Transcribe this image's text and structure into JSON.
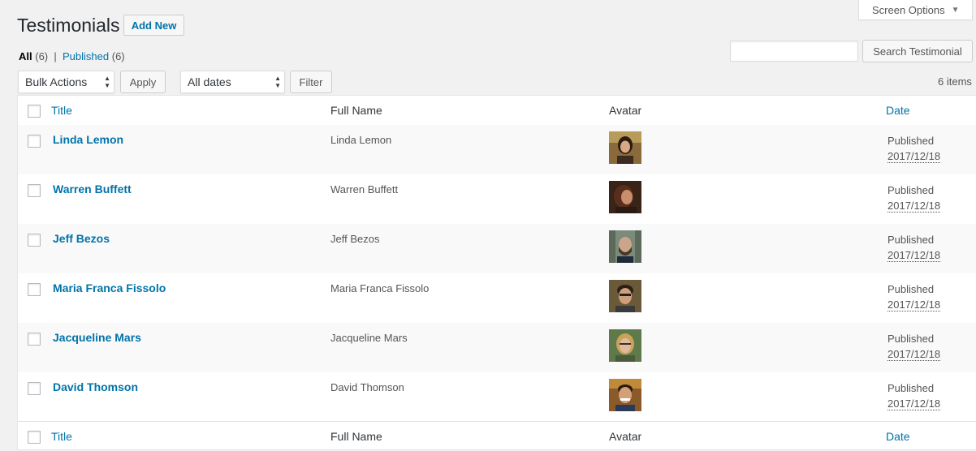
{
  "screen_options": {
    "label": "Screen Options",
    "arrow": "▼"
  },
  "page": {
    "title": "Testimonials",
    "add_new": "Add New"
  },
  "views": {
    "all_label": "All",
    "all_count": "(6)",
    "separator": "|",
    "published_label": "Published",
    "published_count": "(6)"
  },
  "search": {
    "placeholder": "",
    "button": "Search Testimonial"
  },
  "bulk": {
    "selected": "Bulk Actions",
    "apply": "Apply"
  },
  "dates": {
    "selected": "All dates",
    "filter": "Filter"
  },
  "items_count": "6 items",
  "columns": {
    "title": "Title",
    "full_name": "Full Name",
    "avatar": "Avatar",
    "date": "Date"
  },
  "rows": [
    {
      "title": "Linda Lemon",
      "full_name": "Linda Lemon",
      "status": "Published",
      "date": "2017/12/18"
    },
    {
      "title": "Warren Buffett",
      "full_name": "Warren Buffett",
      "status": "Published",
      "date": "2017/12/18"
    },
    {
      "title": "Jeff Bezos",
      "full_name": "Jeff Bezos",
      "status": "Published",
      "date": "2017/12/18"
    },
    {
      "title": "Maria Franca Fissolo",
      "full_name": "Maria Franca Fissolo",
      "status": "Published",
      "date": "2017/12/18"
    },
    {
      "title": "Jacqueline Mars",
      "full_name": "Jacqueline Mars",
      "status": "Published",
      "date": "2017/12/18"
    },
    {
      "title": "David Thomson",
      "full_name": "David Thomson",
      "status": "Published",
      "date": "2017/12/18"
    }
  ],
  "colors": {
    "link": "#0073aa",
    "background": "#f1f1f1",
    "alt_row": "#f9f9f9"
  }
}
